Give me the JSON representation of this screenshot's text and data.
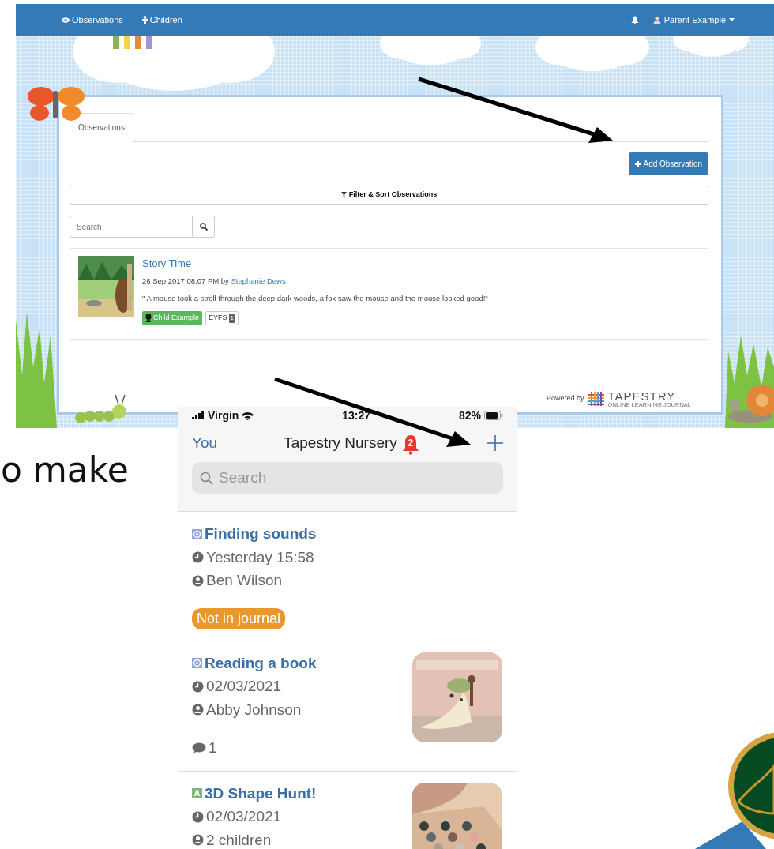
{
  "slide_text": "o make",
  "web": {
    "nav_links": [
      {
        "label": "Observations"
      },
      {
        "label": "Children"
      }
    ],
    "user": "Parent Example",
    "tabs": [
      {
        "label": "Observations",
        "selected": true
      }
    ],
    "add_button": "Add Observation",
    "filter_button": "Filter & Sort Observations",
    "search": {
      "placeholder": "Search"
    },
    "observations": [
      {
        "title": "Story Time",
        "meta": "26 Sep 2017 08:07 PM by",
        "author": "Stephanie Dews",
        "quote": "\" A mouse took a stroll through the deep dark woods, a fox saw the mouse and the mouse looked good!\"",
        "child_tag": "Child Example",
        "framework_tag": "EYFS",
        "framework_count": "1"
      }
    ],
    "powered_by": "Powered by",
    "brand": "TAPESTRY",
    "brand_sub": "ONLINE LEARNING JOURNAL"
  },
  "phone": {
    "carrier": "Virgin",
    "time": "13:27",
    "battery": "82%",
    "back": "You",
    "title": "Tapestry Nursery",
    "notifications": "2",
    "search": {
      "placeholder": "Search"
    },
    "items": [
      {
        "kind": "observation",
        "title": "Finding sounds",
        "date": "Yesterday 15:58",
        "child": "Ben Wilson",
        "tag": "Not in journal",
        "picture": false
      },
      {
        "kind": "observation",
        "title": "Reading a book",
        "date": "02/03/2021",
        "child": "Abby Johnson",
        "comments": "1",
        "picture": true
      },
      {
        "kind": "activity",
        "letter": "A",
        "title": "3D Shape Hunt!",
        "date": "02/03/2021",
        "child": "2 children",
        "picture": true
      }
    ]
  }
}
